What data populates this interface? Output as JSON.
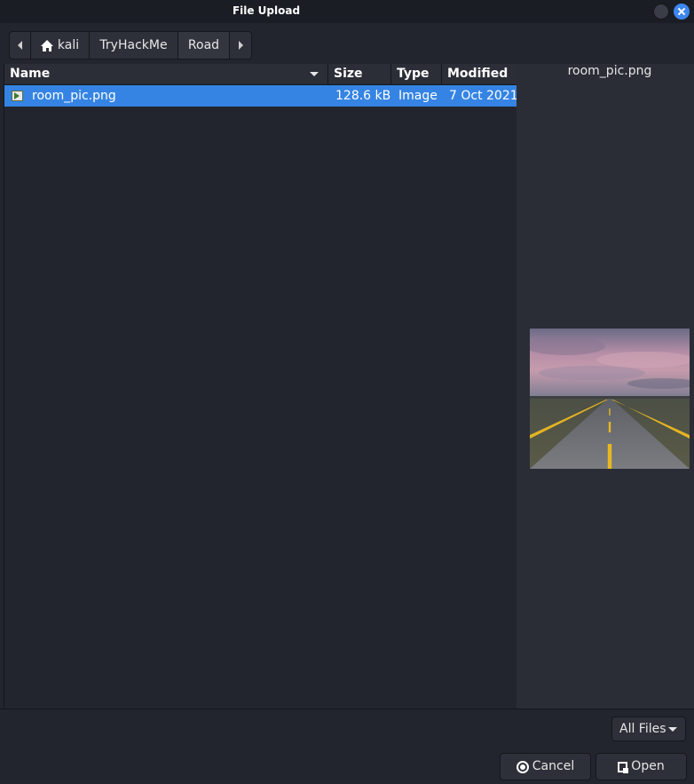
{
  "window": {
    "title": "File Upload"
  },
  "pathbar": {
    "segments": [
      "kali",
      "TryHackMe",
      "Road"
    ],
    "icons": {
      "back": "arrow-left-icon",
      "home": "home-icon",
      "forward": "arrow-right-icon"
    }
  },
  "columns": {
    "name": "Name",
    "size": "Size",
    "type": "Type",
    "modified": "Modified"
  },
  "files": [
    {
      "name": "room_pic.png",
      "size": "128.6 kB",
      "type": "Image",
      "modified": "7 Oct 2021",
      "selected": true,
      "icon": "image-file-icon"
    }
  ],
  "preview": {
    "filename": "room_pic.png"
  },
  "filter": {
    "selected": "All Files"
  },
  "buttons": {
    "cancel": "Cancel",
    "open": "Open"
  },
  "colors": {
    "selection": "#3584e4",
    "background": "#23252e",
    "close_button": "#3d86f0"
  }
}
